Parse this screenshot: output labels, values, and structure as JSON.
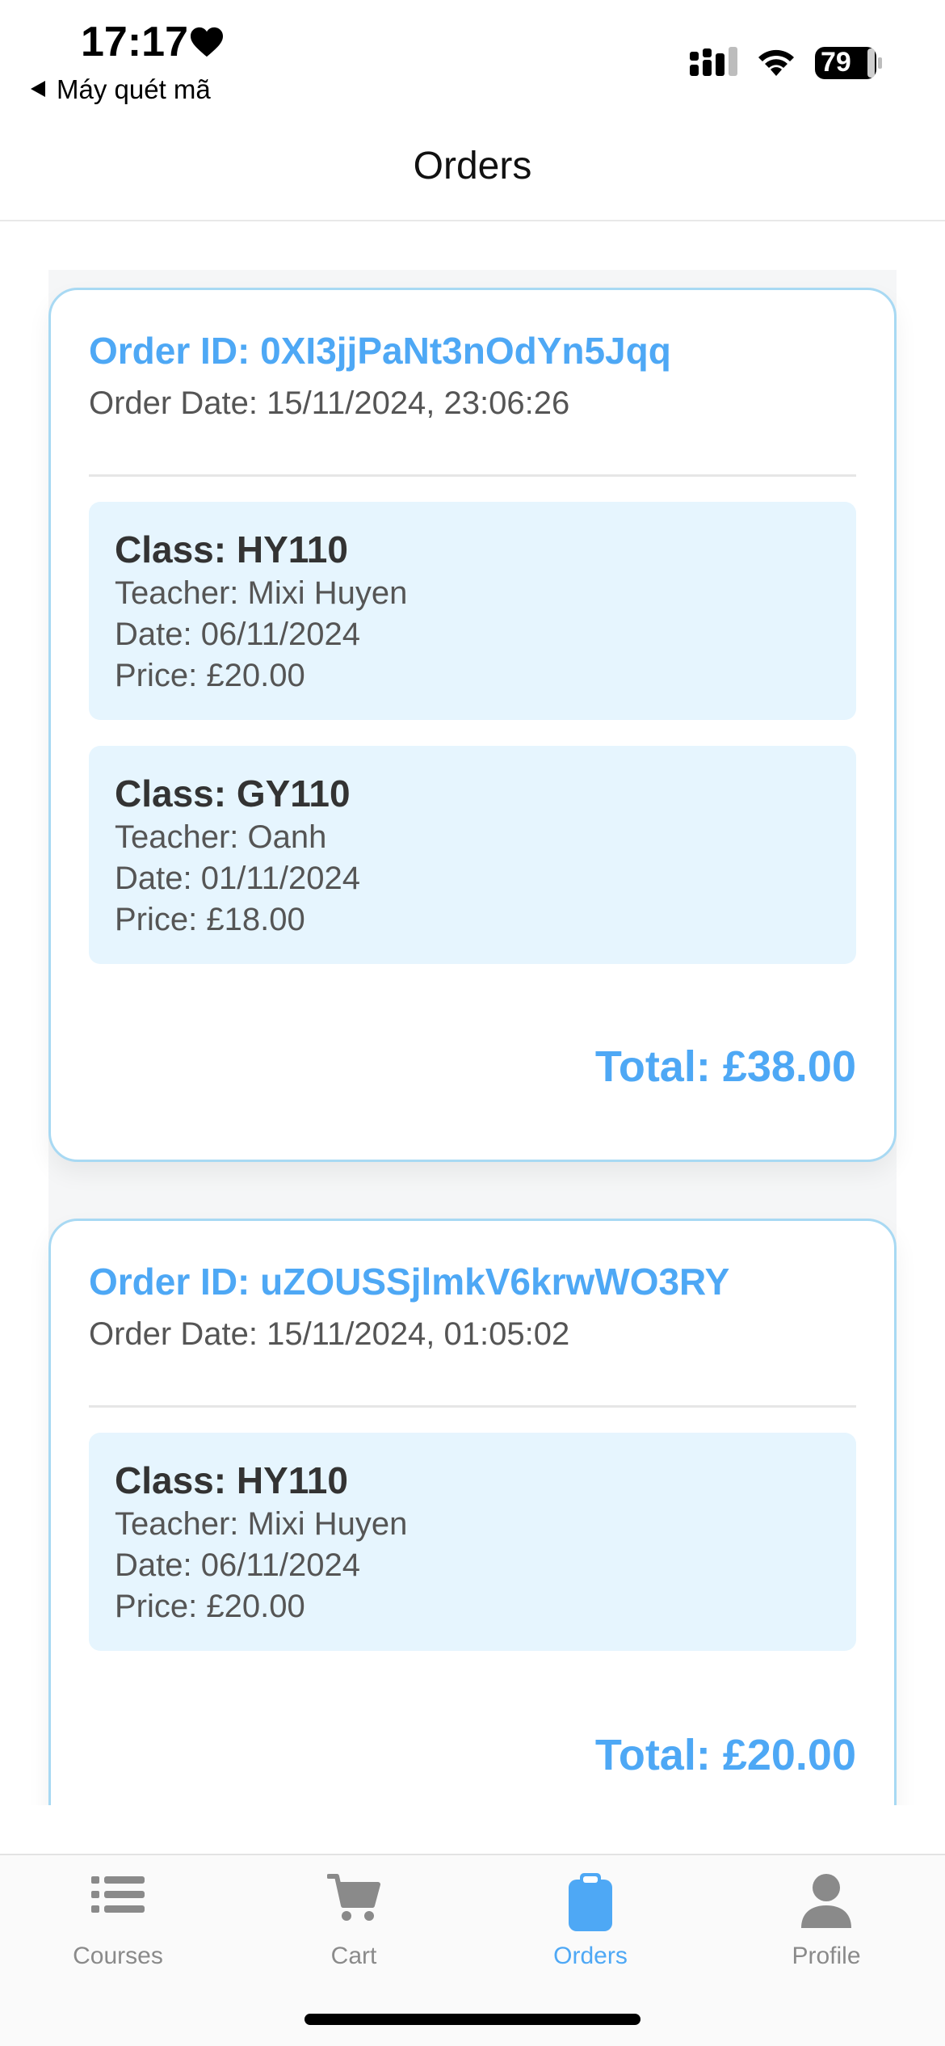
{
  "status_bar": {
    "time": "17:17",
    "back_app": "Máy quét mã",
    "battery": "79"
  },
  "header": {
    "title": "Orders"
  },
  "orders": [
    {
      "id_text": "Order ID: 0XI3jjPaNt3nOdYn5Jqq",
      "date_text": "Order Date: 15/11/2024, 23:06:26",
      "items": [
        {
          "class": "Class: HY110",
          "teacher": "Teacher: Mixi Huyen",
          "date": "Date: 06/11/2024",
          "price": "Price: £20.00"
        },
        {
          "class": "Class: GY110",
          "teacher": "Teacher: Oanh",
          "date": "Date: 01/11/2024",
          "price": "Price: £18.00"
        }
      ],
      "total": "Total: £38.00"
    },
    {
      "id_text": "Order ID: uZOUSSjlmkV6krwWO3RY",
      "date_text": "Order Date: 15/11/2024, 01:05:02",
      "items": [
        {
          "class": "Class: HY110",
          "teacher": "Teacher: Mixi Huyen",
          "date": "Date: 06/11/2024",
          "price": "Price: £20.00"
        }
      ],
      "total": "Total: £20.00"
    }
  ],
  "tabs": [
    {
      "label": "Courses",
      "icon": "list-icon"
    },
    {
      "label": "Cart",
      "icon": "cart-icon"
    },
    {
      "label": "Orders",
      "icon": "clipboard-icon"
    },
    {
      "label": "Profile",
      "icon": "person-icon"
    }
  ],
  "active_tab": "Orders",
  "colors": {
    "accent": "#4ea8f5",
    "card_border": "#a8d9f3",
    "item_bg": "#e6f5fe",
    "inactive": "#8a8a8a"
  }
}
